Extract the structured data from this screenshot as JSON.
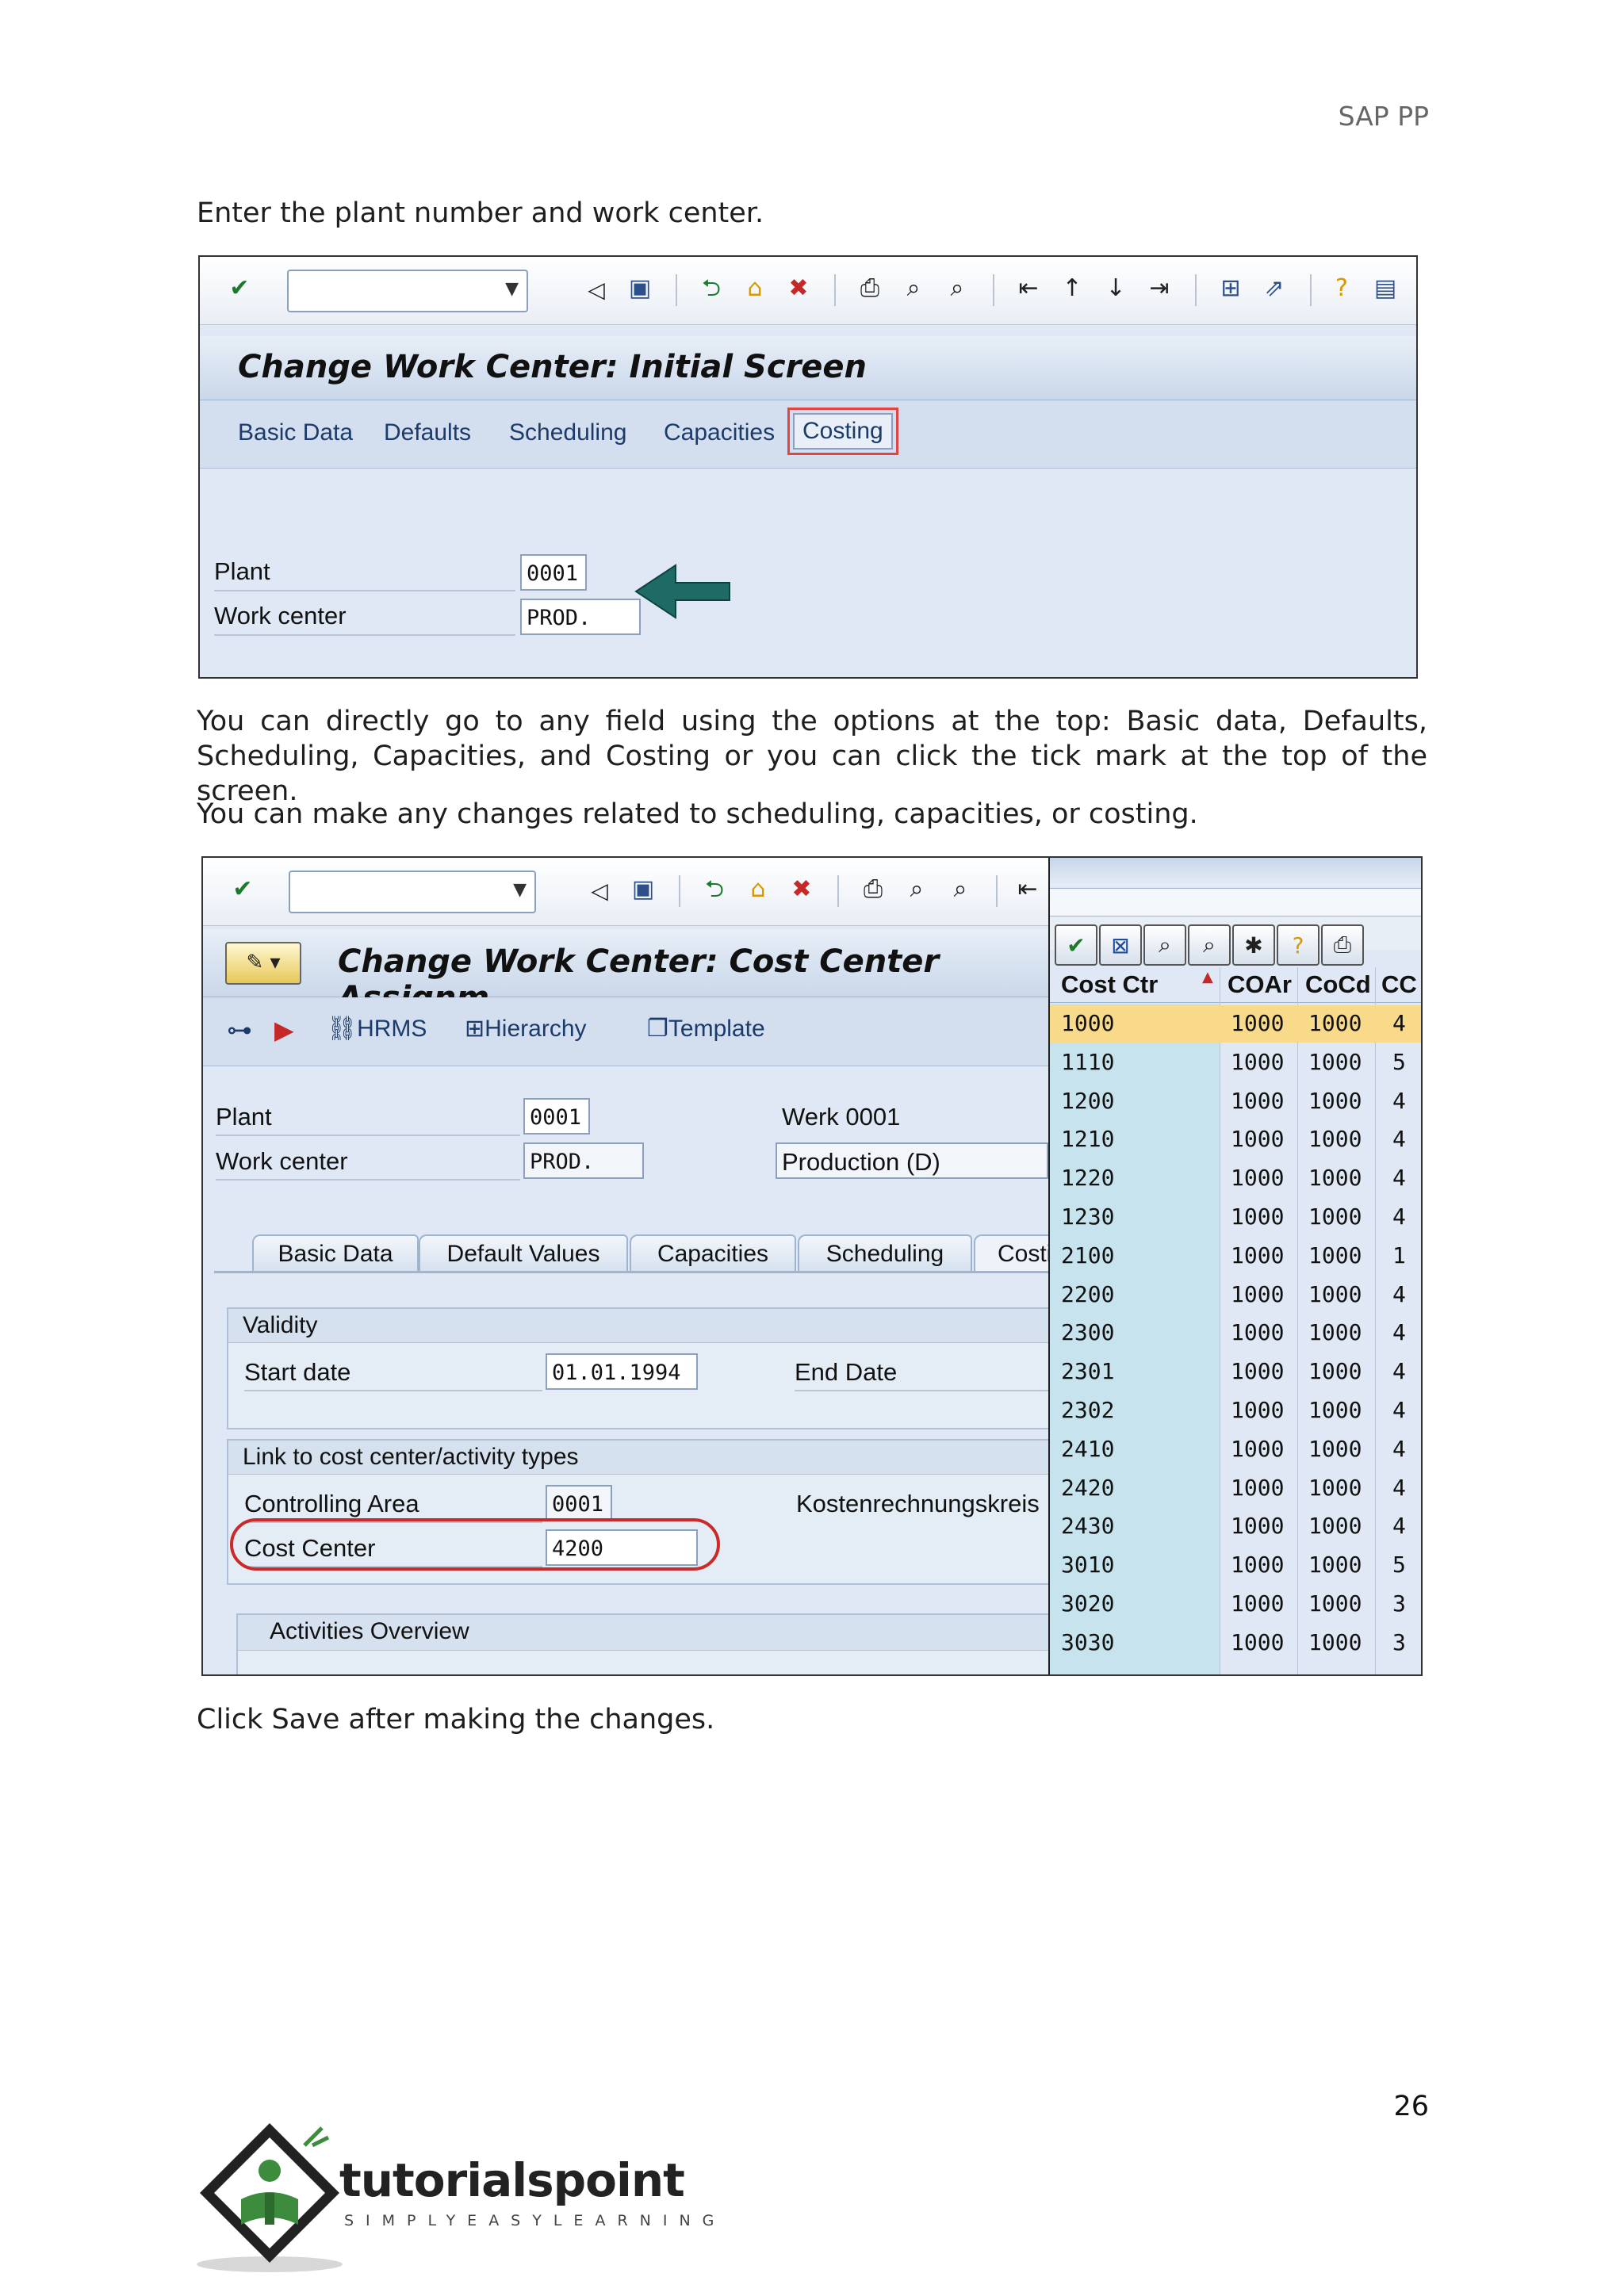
{
  "header": {
    "title": "SAP PP"
  },
  "intro": {
    "text": "Enter the plant number and work center."
  },
  "screen1": {
    "title": "Change Work Center: Initial Screen",
    "nav": [
      "Basic Data",
      "Defaults",
      "Scheduling",
      "Capacities",
      "Costing"
    ],
    "fields": [
      {
        "label": "Plant",
        "value": "0001"
      },
      {
        "label": "Work center",
        "value": "PROD."
      }
    ],
    "icons": [
      "check-icon",
      "back-icon",
      "save-icon",
      "green-arrow-icon",
      "exit-icon",
      "cancel-icon",
      "print-icon",
      "find-icon",
      "find-next-icon",
      "first-page-icon",
      "prev-page-icon",
      "next-page-icon",
      "last-page-icon",
      "new-session-icon",
      "shortcut-icon",
      "help-icon",
      "layout-icon"
    ]
  },
  "para1": {
    "text": "You can directly go to any field using the options at the top: Basic data, Defaults, Scheduling, Capacities, and Costing or you can click the tick mark at the top of the screen."
  },
  "para2": {
    "text": "You can make any changes related to scheduling, capacities, or costing."
  },
  "screen2": {
    "title": "Change Work Center: Cost Center Assignm",
    "toolbar": {
      "hrms": "HRMS",
      "hierarchy": "Hierarchy",
      "template": "Template"
    },
    "plant_label": "Plant",
    "plant_value": "0001",
    "plant_desc": "Werk 0001",
    "wc_label": "Work center",
    "wc_value": "PROD.",
    "wc_desc": "Production (D)",
    "tabs": [
      "Basic Data",
      "Default Values",
      "Capacities",
      "Scheduling",
      "Costi"
    ],
    "validity": {
      "title": "Validity",
      "start_label": "Start date",
      "start_value": "01.01.1994",
      "end_label": "End Date"
    },
    "link": {
      "title": "Link to cost center/activity types",
      "ca_label": "Controlling Area",
      "ca_value": "0001",
      "ca_desc": "Kostenrechnungskreis",
      "cc_label": "Cost Center",
      "cc_value": "4200"
    },
    "activities": {
      "title": "Activities Overview"
    }
  },
  "popup": {
    "columns": [
      "Cost Ctr",
      "COAr",
      "CoCd",
      "CC"
    ],
    "rows": [
      [
        "1000",
        "1000",
        "1000",
        "4"
      ],
      [
        "1110",
        "1000",
        "1000",
        "5"
      ],
      [
        "1200",
        "1000",
        "1000",
        "4"
      ],
      [
        "1210",
        "1000",
        "1000",
        "4"
      ],
      [
        "1220",
        "1000",
        "1000",
        "4"
      ],
      [
        "1230",
        "1000",
        "1000",
        "4"
      ],
      [
        "2100",
        "1000",
        "1000",
        "1"
      ],
      [
        "2200",
        "1000",
        "1000",
        "4"
      ],
      [
        "2300",
        "1000",
        "1000",
        "4"
      ],
      [
        "2301",
        "1000",
        "1000",
        "4"
      ],
      [
        "2302",
        "1000",
        "1000",
        "4"
      ],
      [
        "2410",
        "1000",
        "1000",
        "4"
      ],
      [
        "2420",
        "1000",
        "1000",
        "4"
      ],
      [
        "2430",
        "1000",
        "1000",
        "4"
      ],
      [
        "3010",
        "1000",
        "1000",
        "5"
      ],
      [
        "3020",
        "1000",
        "1000",
        "3"
      ],
      [
        "3030",
        "1000",
        "1000",
        "3"
      ]
    ],
    "highlight_color": "#f9d98a"
  },
  "outro": {
    "text": "Click Save after making the changes."
  },
  "footer": {
    "page_number": "26",
    "logo_text": "tutorialspoint",
    "logo_tagline": "SIMPLYEASYLEARNING"
  }
}
